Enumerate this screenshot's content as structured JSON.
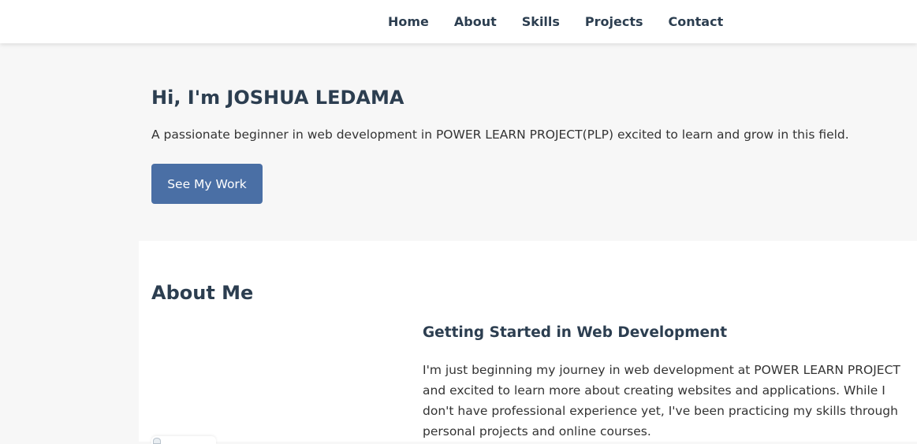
{
  "nav": {
    "items": [
      {
        "label": "Home"
      },
      {
        "label": "About"
      },
      {
        "label": "Skills"
      },
      {
        "label": "Projects"
      },
      {
        "label": "Contact"
      }
    ]
  },
  "hero": {
    "title": "Hi, I'm JOSHUA LEDAMA",
    "subtitle": "A passionate beginner in web development in POWER LEARN PROJECT(PLP) excited to learn and grow in this field.",
    "button_label": "See My Work"
  },
  "about": {
    "heading": "About Me",
    "subheading": "Getting Started in Web Development",
    "paragraph": "I'm just beginning my journey in web development at POWER LEARN PROJECT and excited to learn more about creating websites and applications. While I don't have professional experience yet, I've been practicing my skills through personal projects and online courses.",
    "image_icon": "broken-image-icon"
  },
  "colors": {
    "accent": "#4a6fa5",
    "heading": "#2c3e50",
    "background": "#f7f7f7",
    "surface": "#ffffff"
  }
}
